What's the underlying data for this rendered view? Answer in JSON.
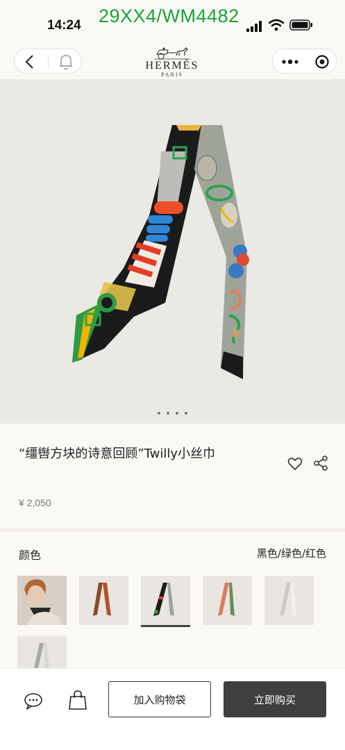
{
  "status_bar": {
    "time": "14:24",
    "watermark": "29XX4/WM4482",
    "watermark_color": "#17a534"
  },
  "nav": {
    "back_icon": "chevron-left-icon",
    "bell_icon": "bell-icon",
    "brand_name": "HERMÈS",
    "brand_city": "PARIS",
    "more_icon": "more-dots-icon",
    "target_icon": "target-icon"
  },
  "gallery": {
    "page_count": 4,
    "current_page": 1,
    "background": "#ebe9e4"
  },
  "product": {
    "title": "“缰辔方块的诗意回顾”Twilly小丝巾",
    "price": "¥ 2,050",
    "favorite_icon": "heart-icon",
    "share_icon": "share-icon"
  },
  "color_section": {
    "label": "颜色",
    "selected_value": "黑色/绿色/红色",
    "swatches": [
      "model-photo",
      "brown-red",
      "black-green-red",
      "white-red-green",
      "white-grey",
      "grey-light"
    ],
    "selected_index": 2
  },
  "bottom_bar": {
    "chat_icon": "chat-icon",
    "bag_icon": "shopping-bag-icon",
    "add_to_cart": "加入购物袋",
    "buy_now": "立即购买",
    "buy_button_color": "#3f3f3f"
  }
}
